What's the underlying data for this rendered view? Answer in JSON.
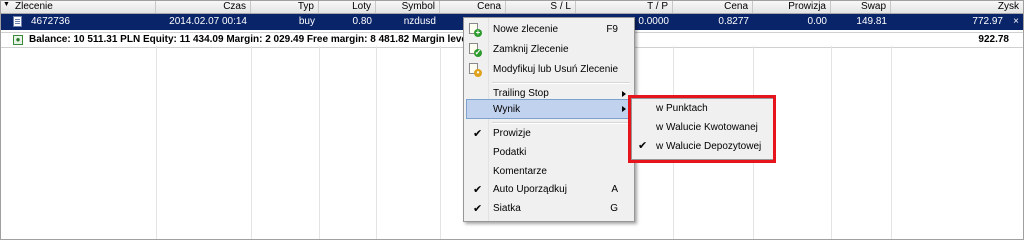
{
  "table": {
    "headers": {
      "zlecenie": "Zlecenie",
      "czas": "Czas",
      "typ": "Typ",
      "loty": "Loty",
      "symbol": "Symbol",
      "cena1": "Cena",
      "sl": "S / L",
      "tp": "T / P",
      "cena2": "Cena",
      "prowizja": "Prowizja",
      "swap": "Swap",
      "zysk": "Zysk"
    },
    "row": {
      "zlecenie": "4672736",
      "czas": "2014.02.07 00:14",
      "typ": "buy",
      "loty": "0.80",
      "symbol": "nzdusd",
      "tp": "0.0000",
      "cena2": "0.8277",
      "prowizja": "0.00",
      "swap": "149.81",
      "zysk": "772.97",
      "close": "×"
    },
    "balance_line": "Balance: 10 511.31 PLN  Equity: 11 434.09  Margin: 2 029.49  Free margin: 8 481.82  Margin level:",
    "total": "922.78"
  },
  "context_menu": {
    "items": [
      {
        "label": "Nowe zlecenie",
        "shortcut": "F9",
        "icon": "new-order-icon"
      },
      {
        "label": "Zamknij Zlecenie",
        "icon": "close-order-icon"
      },
      {
        "label": "Modyfikuj lub Usuń Zlecenie",
        "icon": "modify-order-icon"
      },
      {
        "label": "Trailing Stop"
      },
      {
        "label": "Wynik"
      },
      {
        "label": "Prowizje",
        "checked": true
      },
      {
        "label": "Podatki"
      },
      {
        "label": "Komentarze"
      },
      {
        "label": "Auto Uporządkuj",
        "shortcut": "A",
        "checked": true
      },
      {
        "label": "Siatka",
        "shortcut": "G",
        "checked": true
      }
    ],
    "check_glyph": "✔"
  },
  "submenu": {
    "items": [
      {
        "label": "w Punktach"
      },
      {
        "label": "w Walucie Kwotowanej"
      },
      {
        "label": "w Walucie Depozytowej",
        "checked": true
      }
    ]
  },
  "colors": {
    "selection": "#0a246a",
    "menu_hover": "#c1d2ee",
    "highlight_box": "#e8141b"
  }
}
